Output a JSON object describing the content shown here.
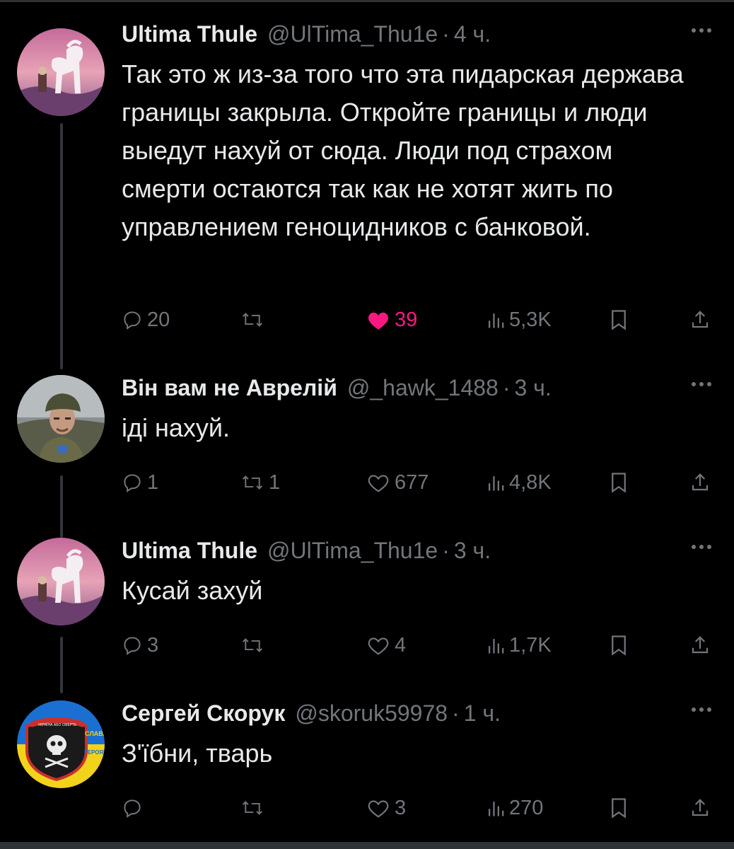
{
  "tweets": [
    {
      "name": "Ultima Thule",
      "handle": "@UlTima_Thu1e",
      "time": "4 ч.",
      "text": "Так это ж из-за того что эта пидарская держава границы закрыла. Откройте границы и люди выедут нахуй от сюда. Люди под страхом смерти остаются так как не хотят жить по управлением геноцидников с банковой.",
      "replies": "20",
      "reposts": "",
      "likes": "39",
      "liked": true,
      "views": "5,3K"
    },
    {
      "name": "Він вам не Аврелій",
      "handle": "@_hawk_1488",
      "time": "3 ч.",
      "text": "іді нахуй.",
      "replies": "1",
      "reposts": "1",
      "likes": "677",
      "liked": false,
      "views": "4,8K"
    },
    {
      "name": "Ultima Thule",
      "handle": "@UlTima_Thu1e",
      "time": "3 ч.",
      "text": "Кусай захуй",
      "replies": "3",
      "reposts": "",
      "likes": "4",
      "liked": false,
      "views": "1,7K"
    },
    {
      "name": "Сергей Скорук",
      "handle": "@skoruk59978",
      "time": "1 ч.",
      "text": "З'їбни, тварь",
      "replies": "",
      "reposts": "",
      "likes": "3",
      "liked": false,
      "views": "270"
    }
  ],
  "avatars": {
    "ultima_thule": "white-horse-pink-sky-icon",
    "aurelius": "soldier-helmet-photo",
    "skoruk": "ukraine-flag-skull-emblem-icon"
  },
  "avatar_badge_text": {
    "top": "УКРАЇНА АБО СМЕРТЬ",
    "slava": "СЛАВА",
    "heroyam": "ГЕРОЯМ"
  },
  "colors": {
    "background": "#000000",
    "text": "#e7e9ea",
    "secondary": "#71767b",
    "like": "#f91880",
    "thread_line": "#333639"
  }
}
